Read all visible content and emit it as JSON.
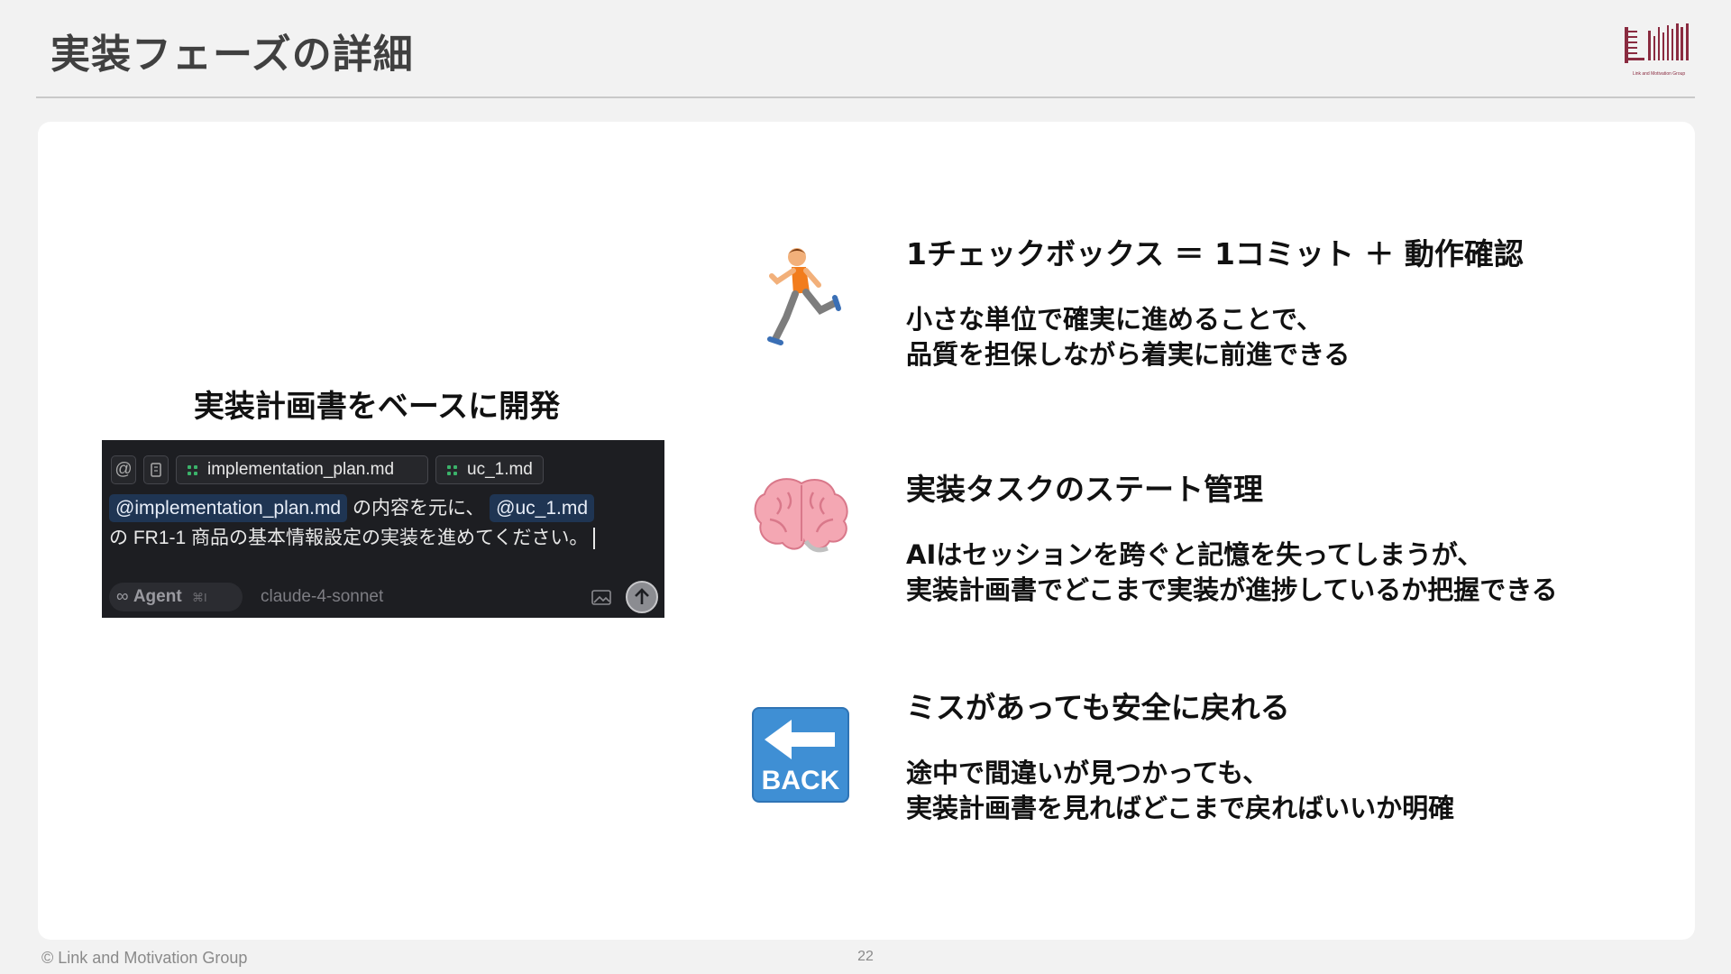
{
  "slide": {
    "title": "実装フェーズの詳細",
    "logo_caption": "Link and Motivation Group",
    "copyright": "© Link and Motivation Group",
    "page_number": "22"
  },
  "left": {
    "heading": "実装計画書をベースに開発",
    "editor": {
      "at_symbol": "@",
      "chips": [
        "implementation_plan.md",
        "uc_1.md"
      ],
      "prompt": {
        "mention1": "@implementation_plan.md",
        "text1": " の内容を元に、 ",
        "mention2": "@uc_1.md",
        "line2": "の FR1-1 商品の基本情報設定の実装を進めてください。"
      },
      "agent_symbol": "∞",
      "agent_label": "Agent",
      "agent_shortcut": "⌘I",
      "model": "claude-4-sonnet"
    }
  },
  "features": [
    {
      "icon": "running-person-icon",
      "title": "1チェックボックス ＝ 1コミット ＋ 動作確認",
      "desc_line1": "小さな単位で確実に進めることで、",
      "desc_line2": "品質を担保しながら着実に前進できる"
    },
    {
      "icon": "brain-icon",
      "title": "実装タスクのステート管理",
      "desc_line1": "AIはセッションを跨ぐと記憶を失ってしまうが、",
      "desc_line2": "実装計画書でどこまで実装が進捗しているか把握できる"
    },
    {
      "icon": "back-arrow-icon",
      "icon_text": "BACK",
      "title": "ミスがあっても安全に戻れる",
      "desc_line1": "途中で間違いが見つかっても、",
      "desc_line2": "実装計画書を見ればどこまで戻ればいいか明確"
    }
  ]
}
